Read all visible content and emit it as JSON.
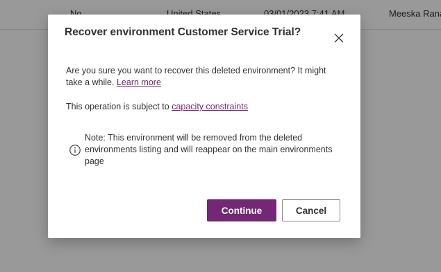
{
  "background_row": {
    "col1": "No",
    "col2": "United States",
    "col3": "03/01/2023 7:41 AM",
    "col4": "Meeska Rana"
  },
  "dialog": {
    "title": "Recover environment Customer Service Trial?",
    "close_icon": "close-icon",
    "question": "Are you sure you want to recover this deleted environment? It might take a while.",
    "learn_more": "Learn more",
    "operation_text": "This operation is subject to",
    "capacity_link": "capacity constraints",
    "note_icon": "info-icon",
    "note": "Note: This environment will be removed from the deleted environments listing and will reappear on the main environments page",
    "continue_label": "Continue",
    "cancel_label": "Cancel"
  },
  "colors": {
    "primary": "#742774",
    "text": "#323130",
    "link": "#742774"
  }
}
